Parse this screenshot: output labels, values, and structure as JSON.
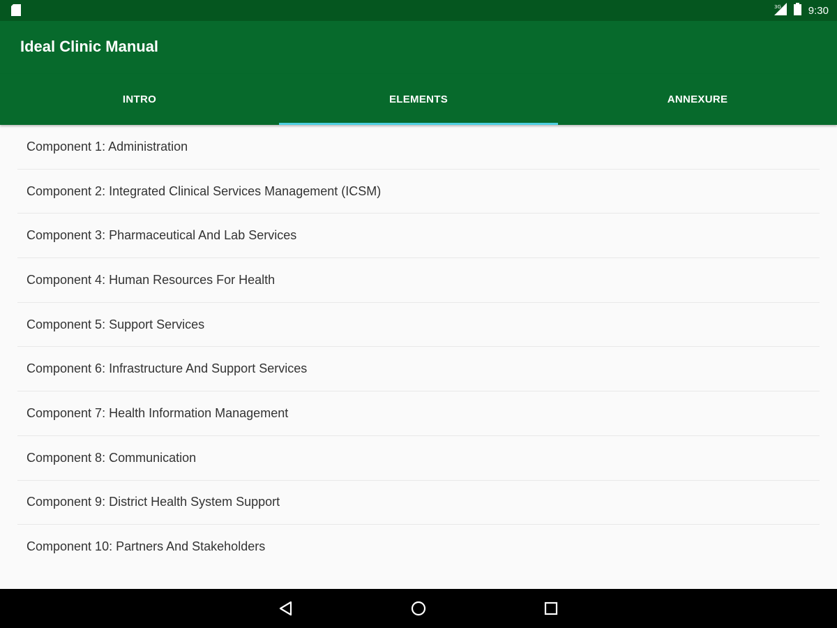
{
  "status_bar": {
    "time": "9:30",
    "icons": [
      "notification-icon",
      "signal-icon",
      "battery-icon"
    ]
  },
  "app_bar": {
    "title": "Ideal Clinic Manual"
  },
  "tabs": [
    {
      "label": "INTRO"
    },
    {
      "label": "ELEMENTS"
    },
    {
      "label": "ANNEXURE"
    }
  ],
  "active_tab": "ELEMENTS",
  "components": [
    {
      "label": "Component 1: Administration"
    },
    {
      "label": "Component 2: Integrated Clinical Services Management (ICSM)"
    },
    {
      "label": "Component 3: Pharmaceutical And Lab Services"
    },
    {
      "label": "Component 4: Human Resources For Health"
    },
    {
      "label": "Component 5: Support Services"
    },
    {
      "label": "Component 6: Infrastructure And Support Services"
    },
    {
      "label": "Component 7: Health Information Management"
    },
    {
      "label": "Component 8: Communication"
    },
    {
      "label": "Component 9: District Health System Support"
    },
    {
      "label": "Component 10: Partners And Stakeholders"
    }
  ],
  "nav_bar": {
    "icons": [
      "back-icon",
      "home-icon",
      "recent-apps-icon"
    ]
  },
  "colors": {
    "primary": "#076a2c",
    "primary_dark": "#05561f",
    "tab_indicator": "#4dd0e1"
  }
}
